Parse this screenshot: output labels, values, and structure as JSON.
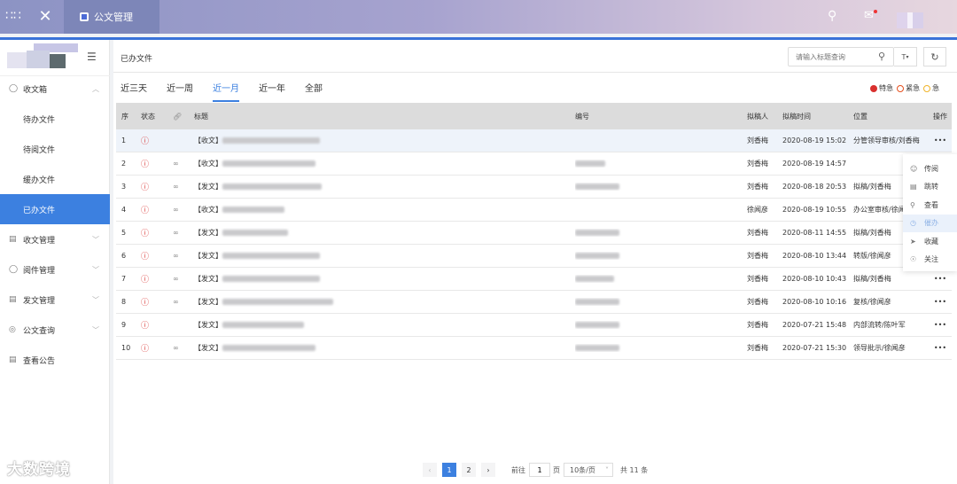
{
  "header": {
    "app_tab_label": "公文管理",
    "grid_icon": "grid-icon",
    "logo_icon": "logo-icon",
    "search_icon": "search-icon",
    "message_icon": "message-icon"
  },
  "sidebar": {
    "items": [
      {
        "label": "收文箱",
        "icon": "inbox-icon",
        "chevron": "︿",
        "level": "top"
      },
      {
        "label": "待办文件",
        "level": "sub"
      },
      {
        "label": "待阅文件",
        "level": "sub"
      },
      {
        "label": "缓办文件",
        "level": "sub"
      },
      {
        "label": "已办文件",
        "level": "sub",
        "active": true
      },
      {
        "label": "收文管理",
        "icon": "document-icon",
        "chevron": "﹀",
        "level": "top"
      },
      {
        "label": "阅件管理",
        "icon": "read-icon",
        "chevron": "﹀",
        "level": "top"
      },
      {
        "label": "发文管理",
        "icon": "send-icon",
        "chevron": "﹀",
        "level": "top"
      },
      {
        "label": "公文查询",
        "icon": "query-icon",
        "chevron": "﹀",
        "level": "top"
      },
      {
        "label": "查看公告",
        "icon": "notice-icon",
        "chevron": "",
        "level": "top"
      }
    ]
  },
  "main": {
    "breadcrumb": "已办文件",
    "search_placeholder": "请输入标题查询",
    "t_button_label": "T",
    "tabs": [
      {
        "label": "近三天"
      },
      {
        "label": "近一周"
      },
      {
        "label": "近一月",
        "active": true
      },
      {
        "label": "近一年"
      },
      {
        "label": "全部"
      }
    ],
    "legend": [
      {
        "label": "特急",
        "color": "#d9302e"
      },
      {
        "label": "紧急",
        "color": "#e6501e"
      },
      {
        "label": "急",
        "color": "#f0b429"
      }
    ]
  },
  "table": {
    "headers": {
      "no": "序",
      "status": "状态",
      "title": "标题",
      "number": "编号",
      "drafter": "拟稿人",
      "draft_time": "拟稿时间",
      "position": "位置",
      "operation": "操作"
    },
    "rows": [
      {
        "no": "1",
        "prefix": "【收文】",
        "drafter": "刘香梅",
        "time": "2020-08-19 15:02",
        "position": "分管领导审核/刘香梅",
        "has_link": false
      },
      {
        "no": "2",
        "prefix": "【收文】",
        "drafter": "刘香梅",
        "time": "2020-08-19 14:57",
        "position": "",
        "has_link": true
      },
      {
        "no": "3",
        "prefix": "【发文】",
        "drafter": "刘香梅",
        "time": "2020-08-18 20:53",
        "position": "拟稿/刘香梅",
        "has_link": true
      },
      {
        "no": "4",
        "prefix": "【收文】",
        "drafter": "徐闻彦",
        "time": "2020-08-19 10:55",
        "position": "办公室审核/徐闻",
        "has_link": true
      },
      {
        "no": "5",
        "prefix": "【发文】",
        "drafter": "刘香梅",
        "time": "2020-08-11 14:55",
        "position": "拟稿/刘香梅",
        "has_link": true
      },
      {
        "no": "6",
        "prefix": "【发文】",
        "drafter": "刘香梅",
        "time": "2020-08-10 13:44",
        "position": "转版/徐闻彦",
        "has_link": true
      },
      {
        "no": "7",
        "prefix": "【发文】",
        "drafter": "刘香梅",
        "time": "2020-08-10 10:43",
        "position": "拟稿/刘香梅",
        "has_link": true
      },
      {
        "no": "8",
        "prefix": "【发文】",
        "drafter": "刘香梅",
        "time": "2020-08-10 10:16",
        "position": "复核/徐闻彦",
        "has_link": true
      },
      {
        "no": "9",
        "prefix": "【发文】",
        "drafter": "刘香梅",
        "time": "2020-07-21 15:48",
        "position": "内部流转/陈叶军",
        "has_link": false
      },
      {
        "no": "10",
        "prefix": "【发文】",
        "drafter": "刘香梅",
        "time": "2020-07-21 15:30",
        "position": "领导批示/徐闻彦",
        "has_link": true
      }
    ],
    "more_label": "•••"
  },
  "op_menu": {
    "items": [
      {
        "label": "传阅",
        "icon": "circulate-icon"
      },
      {
        "label": "跳转",
        "icon": "jump-icon"
      },
      {
        "label": "查看",
        "icon": "view-icon"
      },
      {
        "label": "催办",
        "icon": "urge-icon",
        "active": true
      },
      {
        "label": "收藏",
        "icon": "favorite-icon"
      },
      {
        "label": "关注",
        "icon": "follow-icon"
      }
    ]
  },
  "pagination": {
    "prev": "‹",
    "pages": [
      "1",
      "2"
    ],
    "current": "1",
    "next": "›",
    "goto_label": "前往",
    "goto_value": "1",
    "page_unit": "页",
    "page_size": "10条/页",
    "total": "共 11 条"
  },
  "watermark": "大数跨境"
}
